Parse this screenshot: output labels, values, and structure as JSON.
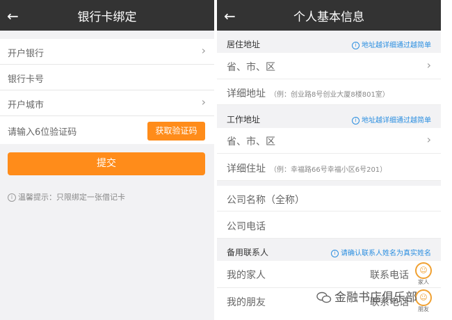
{
  "left": {
    "nav_title": "银行卡绑定",
    "rows": [
      {
        "label": "开户银行"
      },
      {
        "label": "银行卡号"
      },
      {
        "label": "开户城市"
      },
      {
        "label": "请输入6位验证码"
      }
    ],
    "get_code_label": "获取验证码",
    "submit_label": "提交",
    "tip_text": "温馨提示：只限绑定一张借记卡"
  },
  "right": {
    "nav_title": "个人基本信息",
    "residence": {
      "header": "居住地址",
      "hint": "地址越详细通过越简单",
      "region_label": "省、市、区",
      "detail_label": "详细地址",
      "detail_example": "（例：创业路8号创业大厦8楼801室）"
    },
    "work": {
      "header": "工作地址",
      "hint": "地址越详细通过越简单",
      "region_label": "省、市、区",
      "detail_label": "详细住址",
      "detail_example": "（例：幸福路66号幸福小区6号201）"
    },
    "company_name": "公司名称（全称）",
    "company_phone": "公司电话",
    "backup": {
      "header": "备用联系人",
      "hint": "请确认联系人姓名为真实姓名",
      "rows": [
        {
          "label": "我的家人",
          "right": "联系电话",
          "icon_caption": "家人"
        },
        {
          "label": "我的朋友",
          "right": "联系电话",
          "icon_caption": "朋友"
        }
      ]
    }
  },
  "watermark": "金融书店俱乐部",
  "colors": {
    "nav": "#333333",
    "accent": "#ff8c1a",
    "hint_blue": "#2a8ee0",
    "background": "#f2f2f4"
  }
}
